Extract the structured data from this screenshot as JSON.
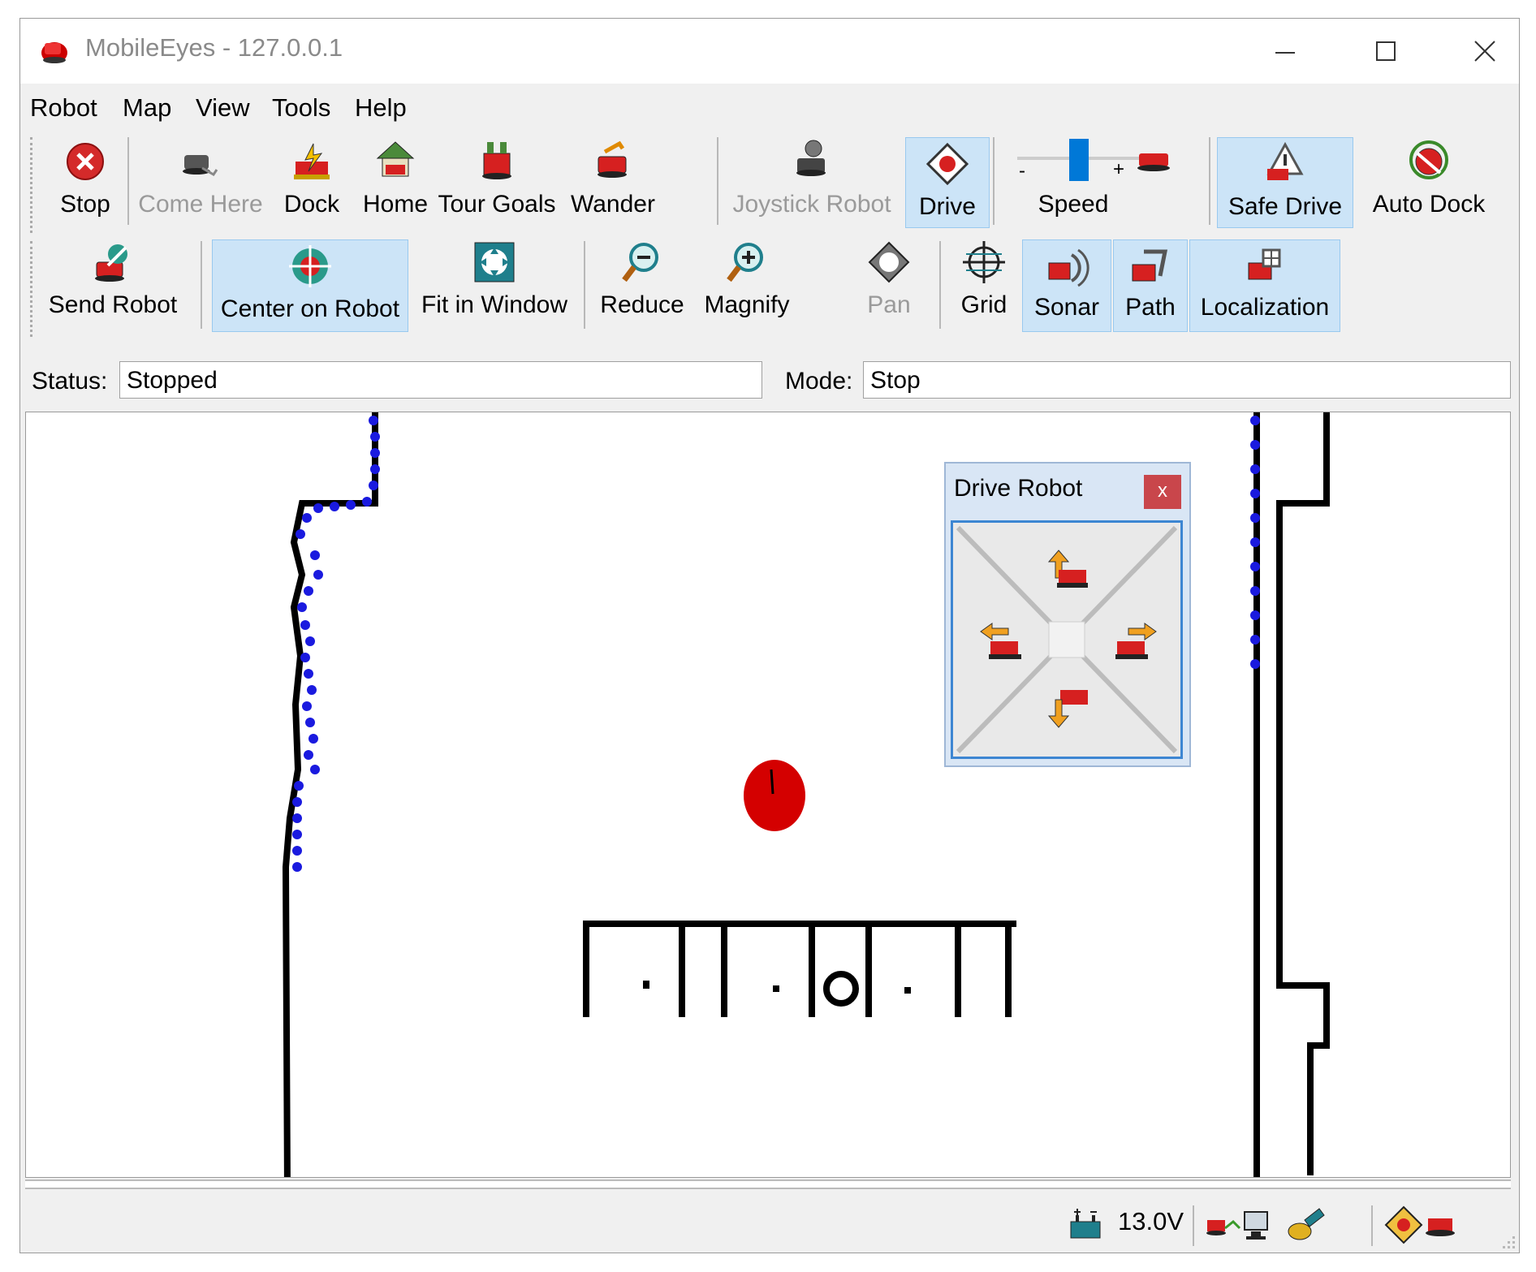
{
  "window": {
    "title": "MobileEyes - 127.0.0.1"
  },
  "menu": [
    "Robot",
    "Map",
    "View",
    "Tools",
    "Help"
  ],
  "toolbar": {
    "row1": {
      "stop": "Stop",
      "come_here": "Come Here",
      "dock": "Dock",
      "home": "Home",
      "tour_goals": "Tour Goals",
      "wander": "Wander",
      "joystick_robot": "Joystick Robot",
      "drive": "Drive",
      "speed": "Speed",
      "speed_minus": "-",
      "speed_plus": "+",
      "safe_drive": "Safe Drive",
      "auto_dock": "Auto Dock"
    },
    "row2": {
      "send_robot": "Send Robot",
      "center_on_robot": "Center on Robot",
      "fit_in_window": "Fit in Window",
      "reduce": "Reduce",
      "magnify": "Magnify",
      "pan": "Pan",
      "grid": "Grid",
      "sonar": "Sonar",
      "path": "Path",
      "localization": "Localization"
    },
    "active": [
      "drive",
      "safe_drive",
      "center_on_robot",
      "sonar",
      "path",
      "localization"
    ],
    "disabled": [
      "come_here",
      "joystick_robot",
      "pan"
    ]
  },
  "status": {
    "status_label": "Status:",
    "status_value": "Stopped",
    "mode_label": "Mode:",
    "mode_value": "Stop"
  },
  "drive_dialog": {
    "title": "Drive Robot",
    "close": "x"
  },
  "bottom": {
    "voltage": "13.0V"
  },
  "colors": {
    "active_bg": "#cce4f7",
    "robot_red": "#d40000",
    "sonar_blue": "#1a1adf",
    "dialog_border": "#3d86d2"
  }
}
